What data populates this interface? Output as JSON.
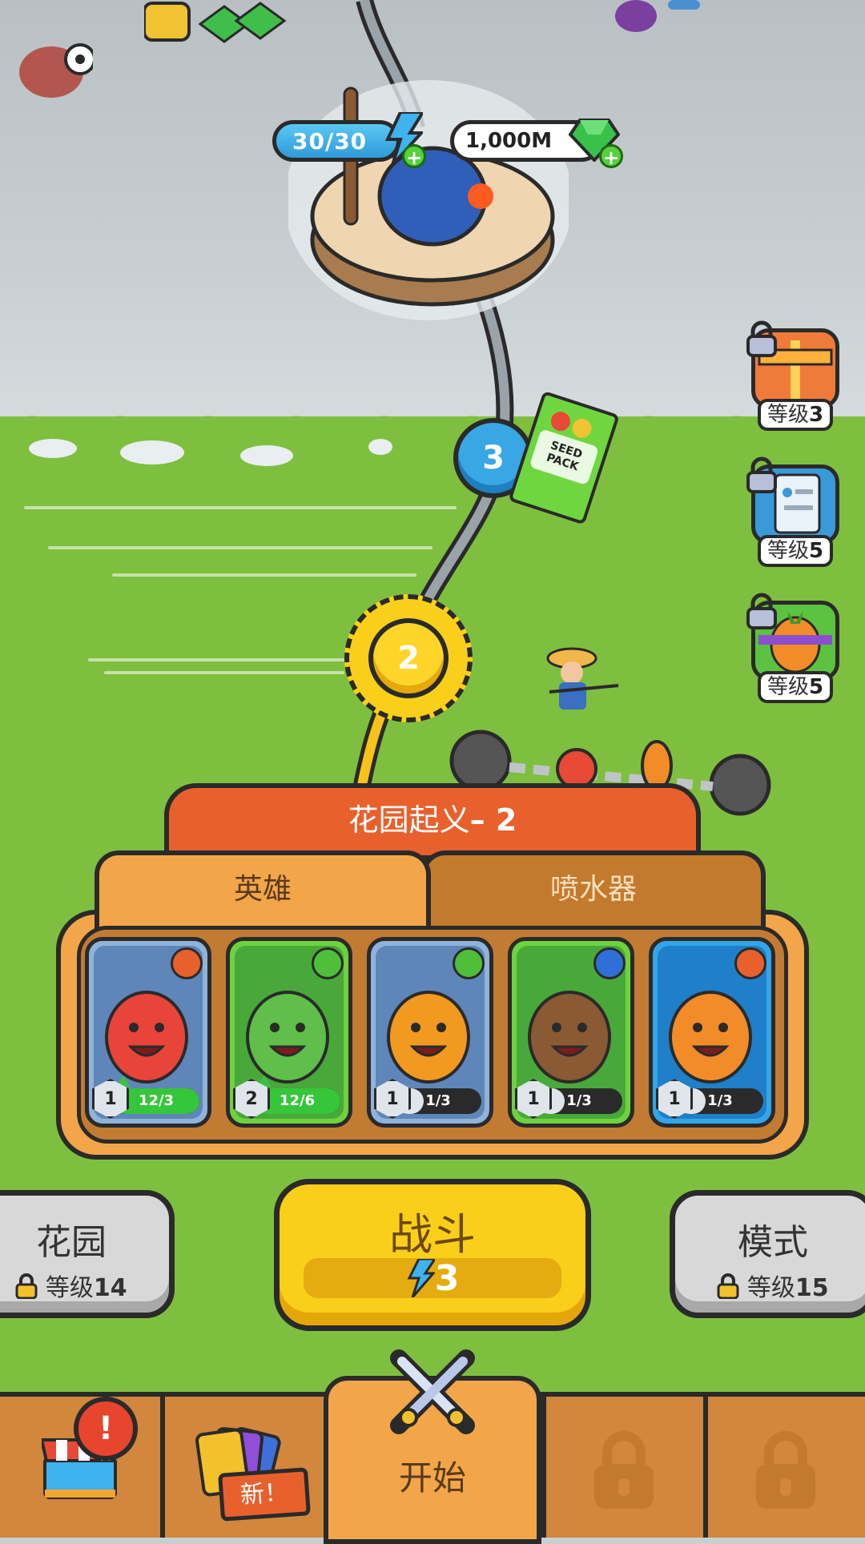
{
  "top_bar": {
    "energy": "30/30",
    "gems": "1,000M"
  },
  "map": {
    "nodes": [
      {
        "number": "3"
      },
      {
        "number": "2"
      }
    ],
    "seed_pack_label": "SEED PACK"
  },
  "side_rewards": [
    {
      "label": "等级",
      "level": "3",
      "icon": "gift-box-icon"
    },
    {
      "label": "等级",
      "level": "5",
      "icon": "clipboard-icon"
    },
    {
      "label": "等级",
      "level": "5",
      "icon": "carrot-pot-icon"
    }
  ],
  "level_panel": {
    "title": "花园起义",
    "number": "– 2",
    "tabs": [
      {
        "label": "英雄",
        "active": true
      },
      {
        "label": "喷水器",
        "active": false
      }
    ],
    "cards": [
      {
        "name": "tomato",
        "level": "1",
        "progress": "12/3",
        "fill": 1.0,
        "role_icon": "sword-icon",
        "can_upgrade": true,
        "frame": "#8fb3d9",
        "bg": "#5f86b8"
      },
      {
        "name": "broccoli",
        "level": "2",
        "progress": "12/6",
        "fill": 1.0,
        "role_icon": "leaf-icon",
        "can_upgrade": true,
        "frame": "#6ed23d",
        "bg": "#49a83a"
      },
      {
        "name": "pumpkin",
        "level": "1",
        "progress": "1/3",
        "fill": 0.33,
        "role_icon": "leaf-icon",
        "can_upgrade": false,
        "frame": "#8fb3d9",
        "bg": "#5f86b8"
      },
      {
        "name": "kiwi",
        "level": "1",
        "progress": "1/3",
        "fill": 0.33,
        "role_icon": "shield-icon",
        "can_upgrade": false,
        "frame": "#6ed23d",
        "bg": "#49a83a"
      },
      {
        "name": "carrot",
        "level": "1",
        "progress": "1/3",
        "fill": 0.33,
        "role_icon": "sword-icon",
        "can_upgrade": false,
        "frame": "#32a6ea",
        "bg": "#1f7fc8"
      }
    ]
  },
  "actions": {
    "garden": {
      "label": "花园",
      "sub": "等级",
      "level": "14"
    },
    "fight": {
      "label": "战斗",
      "cost": "3"
    },
    "mode": {
      "label": "模式",
      "sub": "等级",
      "level": "15"
    }
  },
  "bottom_nav": {
    "shop_alert": "!",
    "cards_badge": "新！",
    "start_label": "开始"
  },
  "colors": {
    "outline": "#2a2a2a",
    "orange": "#e8602c",
    "panel": "#f2a649",
    "yellow": "#f9cf1a",
    "grass": "#7fbf3f"
  }
}
